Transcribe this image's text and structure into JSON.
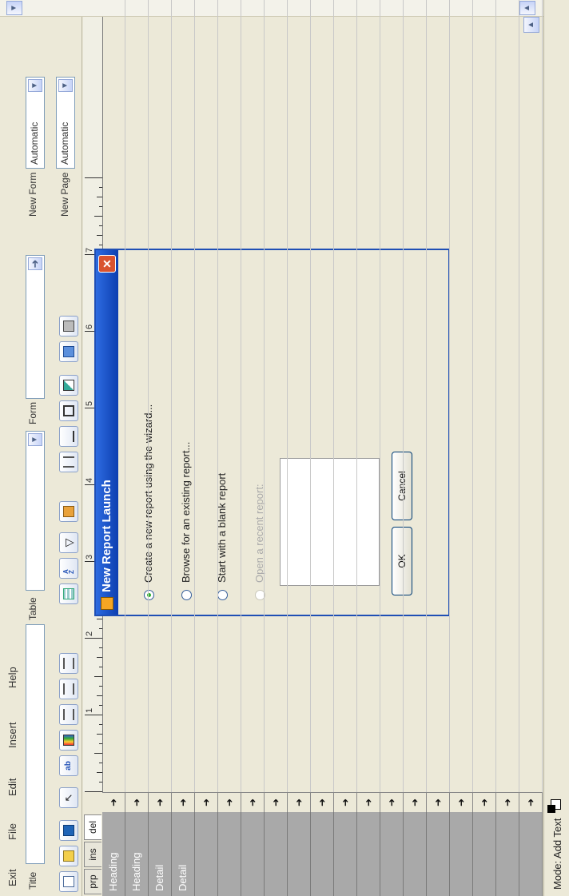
{
  "menu": [
    "Exit",
    "File",
    "Edit",
    "Insert",
    "Help"
  ],
  "toolbar": {
    "title_label": "Title",
    "table_label": "Table",
    "form_label": "Form",
    "new_form_label": "New Form",
    "new_form_value": "Automatic",
    "new_page_label": "New Page",
    "new_page_value": "Automatic"
  },
  "tabs": [
    "prp",
    "ins",
    "del"
  ],
  "sections": [
    "Heading",
    "Heading",
    "Detail",
    "Detail"
  ],
  "ruler_numbers": [
    "1",
    "2",
    "3",
    "4",
    "5",
    "6",
    "7"
  ],
  "row_arrow": "➜",
  "status": {
    "mode": "Mode: Add Text"
  },
  "dialog": {
    "title": "New Report Launch",
    "options": [
      "Create a new report using the wizard...",
      "Browse for an existing report...",
      "Start with a blank report",
      "Open a recent report:"
    ],
    "selected_index": 0,
    "ok_label": "OK",
    "cancel_label": "Cancel"
  },
  "colors": {
    "title_bar": "#1f5ad6",
    "close_button": "#d9532f",
    "selection": "#2bb02b"
  }
}
